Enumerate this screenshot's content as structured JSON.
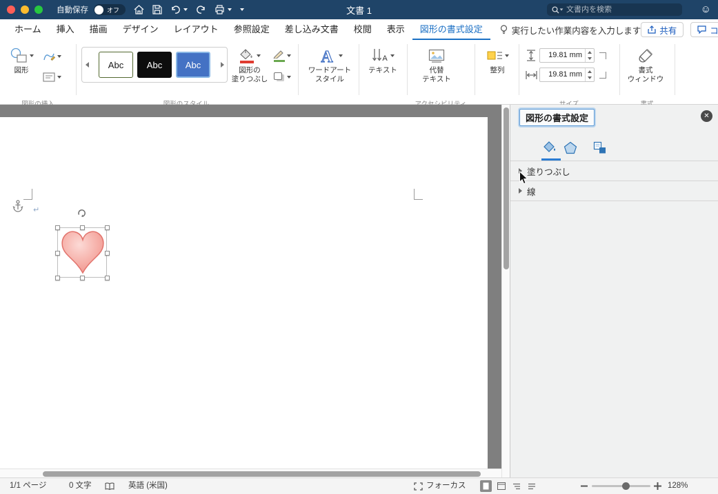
{
  "titlebar": {
    "autosave": "自動保存",
    "autosave_state": "オフ",
    "doc_title": "文書 1",
    "search_placeholder": "文書内を検索"
  },
  "menubar": {
    "tabs": [
      "ホーム",
      "挿入",
      "描画",
      "デザイン",
      "レイアウト",
      "参照設定",
      "差し込み文書",
      "校閲",
      "表示",
      "図形の書式設定"
    ],
    "tell_me": "実行したい作業内容を入力します",
    "share": "共有",
    "comments": "コメント"
  },
  "ribbon": {
    "shapes_label": "図形",
    "style1": "Abc",
    "style2": "Abc",
    "style3": "Abc",
    "shape_fill_1": "図形の",
    "shape_fill_2": "塗りつぶし",
    "wordart_1": "ワードアート",
    "wordart_2": "スタイル",
    "text_label": "テキスト",
    "alt_1": "代替",
    "alt_2": "テキスト",
    "arrange_label": "整列",
    "height_value": "19.81 mm",
    "width_value": "19.81 mm",
    "format_1": "書式",
    "format_2": "ウィンドウ",
    "groups": {
      "insert_shapes": "図形の挿入",
      "shape_styles": "図形のスタイル",
      "accessibility": "アクセシビリティ",
      "size": "サイズ",
      "format": "書式"
    }
  },
  "panel": {
    "title": "図形の書式設定",
    "section_fill": "塗りつぶし",
    "section_line": "線"
  },
  "statusbar": {
    "page": "1/1 ページ",
    "words": "0 文字",
    "language": "英語 (米国)",
    "focus": "フォーカス",
    "zoom": "128%"
  },
  "icons": {
    "close": "✕",
    "smiley": "☺",
    "return_mark": "↵"
  },
  "colors": {
    "titlebar": "#1f4468",
    "accent_blue": "#2b7cd3",
    "fill_red": "#e03c31",
    "line_green": "#6aa84f",
    "style_blue": "#4472c4",
    "heart_stroke": "#e2736c"
  }
}
